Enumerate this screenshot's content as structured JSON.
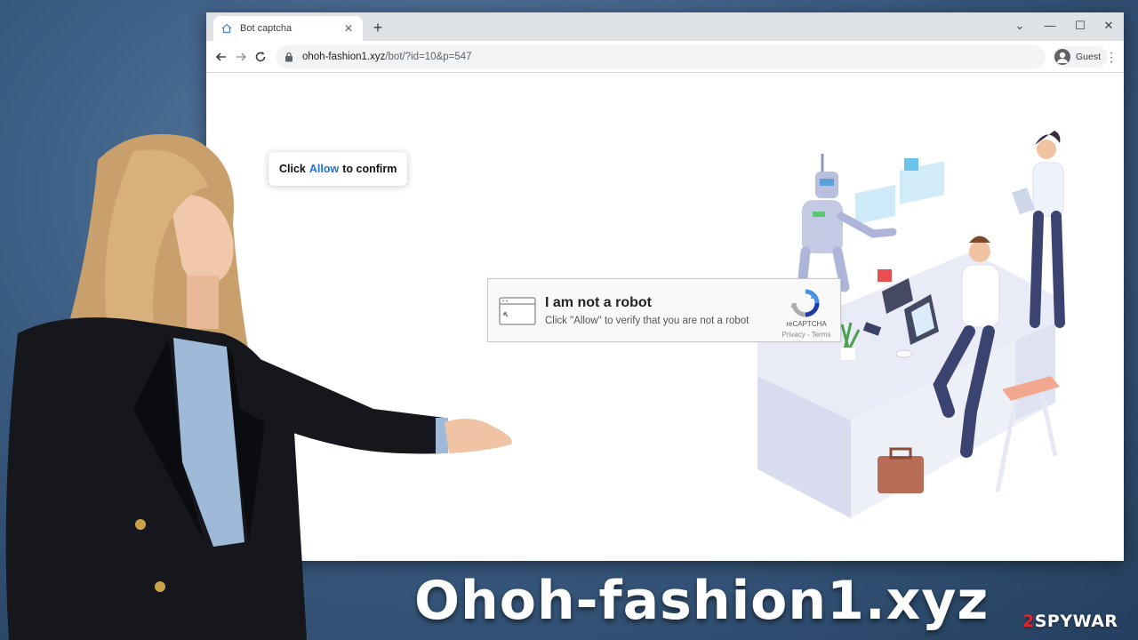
{
  "browser": {
    "tab": {
      "title": "Bot captcha",
      "close_glyph": "✕",
      "favicon": "house-icon"
    },
    "new_tab_glyph": "+",
    "window_controls": {
      "minimize": "—",
      "maximize": "☐",
      "close": "✕",
      "dropdown": "⌄"
    },
    "address": {
      "host": "ohoh-fashion1.xyz",
      "path": "/bot/?id=10&p=547"
    },
    "profile_label": "Guest",
    "menu_glyph": "⋮"
  },
  "page": {
    "popup": {
      "before": "Click",
      "highlight": "Allow",
      "after": "to confirm"
    },
    "captcha": {
      "title": "I am not a robot",
      "subtitle": "Click \"Allow\" to verify that you are not a robot",
      "brand": "reCAPTCHA",
      "terms": "Privacy - Terms"
    }
  },
  "banner": {
    "headline": "Ohoh-fashion1.xyz",
    "watermark_red": "2",
    "watermark_rest": "SPYWAR"
  },
  "colors": {
    "link_blue": "#1a73e8",
    "background": "#3d5f85",
    "watermark_red": "#e2262b"
  }
}
